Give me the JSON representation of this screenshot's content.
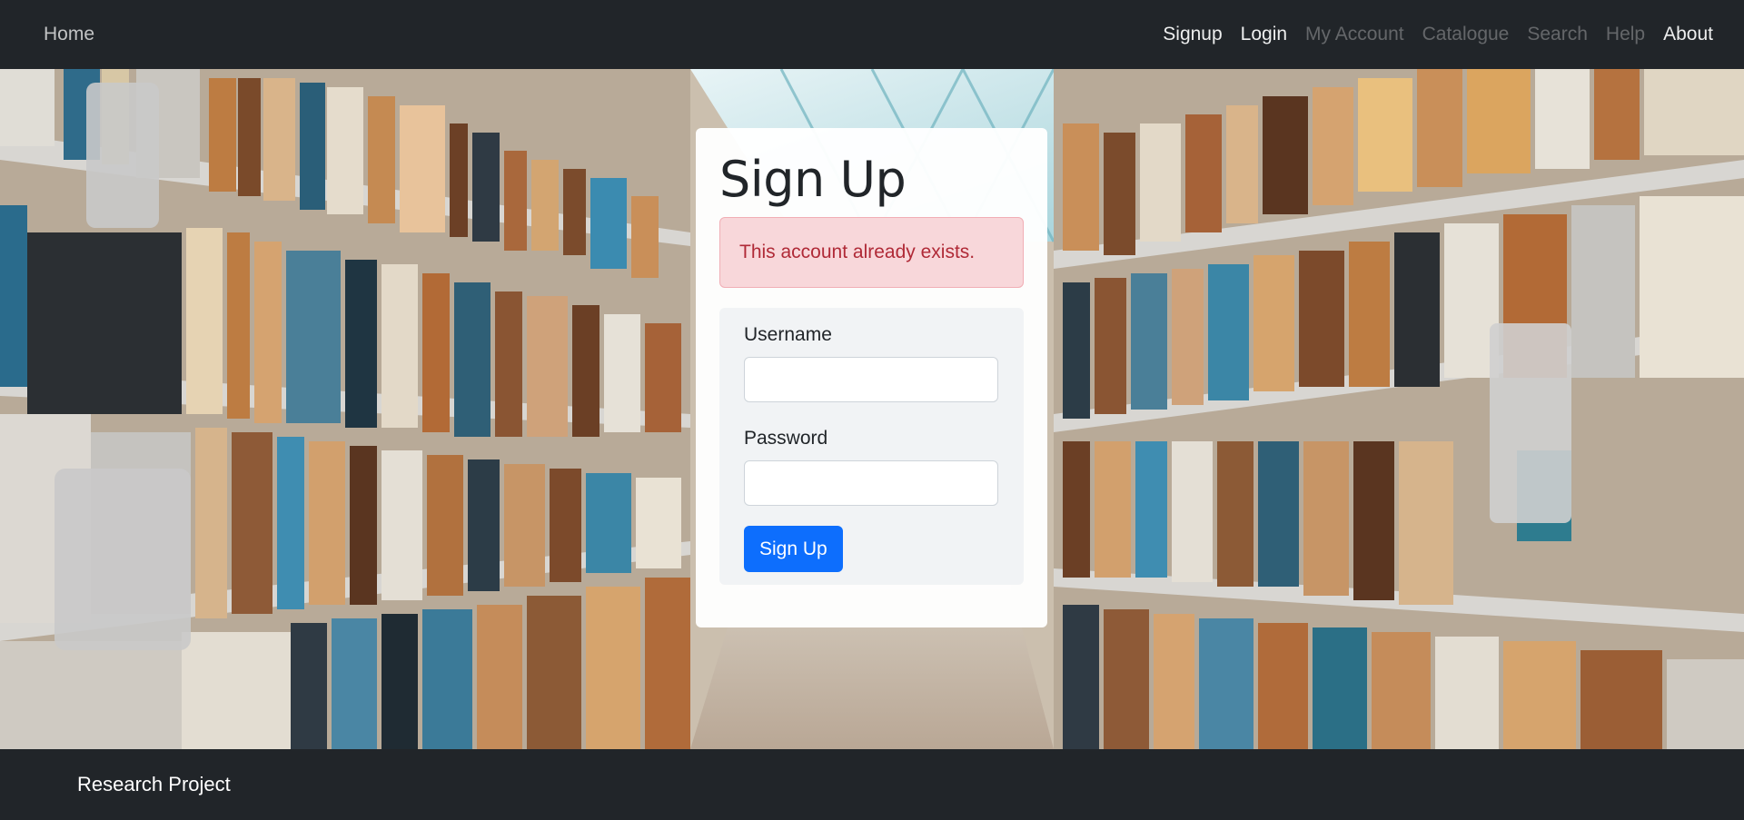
{
  "navbar": {
    "home": "Home",
    "links": [
      {
        "label": "Signup"
      },
      {
        "label": "Login"
      },
      {
        "label": "My Account"
      },
      {
        "label": "Catalogue"
      },
      {
        "label": "Search"
      },
      {
        "label": "Help"
      },
      {
        "label": "About"
      }
    ]
  },
  "signup": {
    "title": "Sign Up",
    "alert": "This account already exists.",
    "username_label": "Username",
    "username_value": "",
    "password_label": "Password",
    "password_value": "",
    "submit_label": "Sign Up"
  },
  "footer": {
    "text": "Research Project"
  },
  "colors": {
    "navbar_bg": "#212529",
    "alert_bg": "#f8d7da",
    "alert_text": "#b02a37",
    "button_primary": "#0d6efd"
  }
}
